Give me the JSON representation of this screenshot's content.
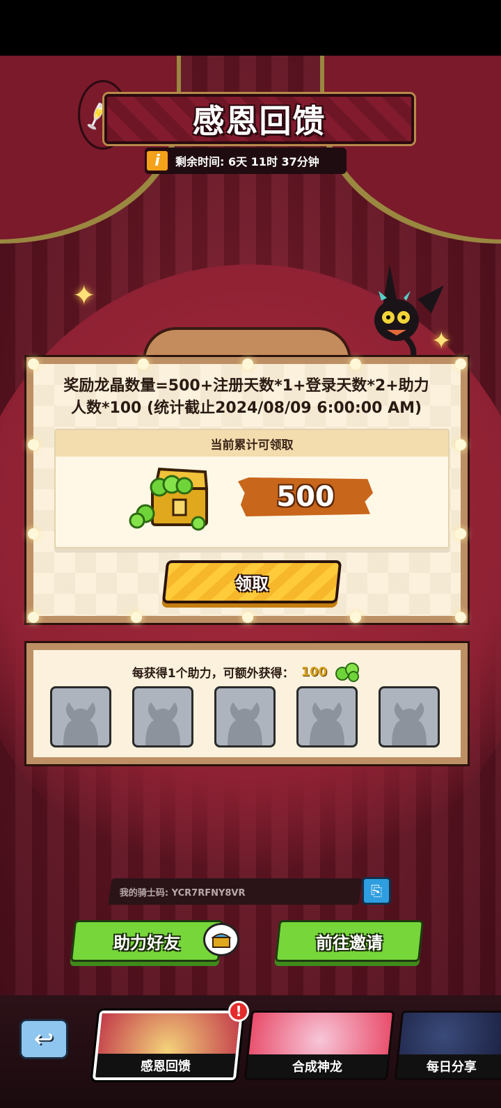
{
  "event": {
    "title": "感恩回馈",
    "timer_text": "剩余时间: 6天 11时 37分钟"
  },
  "reward": {
    "formula_line1": "奖励龙晶数量=500+注册天数*1+登录天数*2+助力",
    "formula_line2": "人数*100 (统计截止2024/08/09 6:00:00 AM)",
    "panel_header": "当前累计可领取",
    "amount": "500",
    "claim_label": "领取"
  },
  "helpers": {
    "bonus_text": "每获得1个助力，可额外获得：",
    "bonus_amount": "100",
    "slots": [
      "",
      "",
      "",
      "",
      ""
    ]
  },
  "knight_code": {
    "text": "我的骑士码: YCR7RFNY8VR"
  },
  "actions": {
    "help_friend_label": "助力好友",
    "invite_label": "前往邀请"
  },
  "tabs": [
    {
      "label": "感恩回馈",
      "active": true
    },
    {
      "label": "合成神龙",
      "active": false
    },
    {
      "label": "每日分享",
      "active": false
    }
  ],
  "colors": {
    "stage": "#6a1726",
    "board_frame": "#bd8f64",
    "claim_button": "#ffcb3a",
    "green_button": "#76d63a",
    "amount_brush": "#c8661c"
  }
}
